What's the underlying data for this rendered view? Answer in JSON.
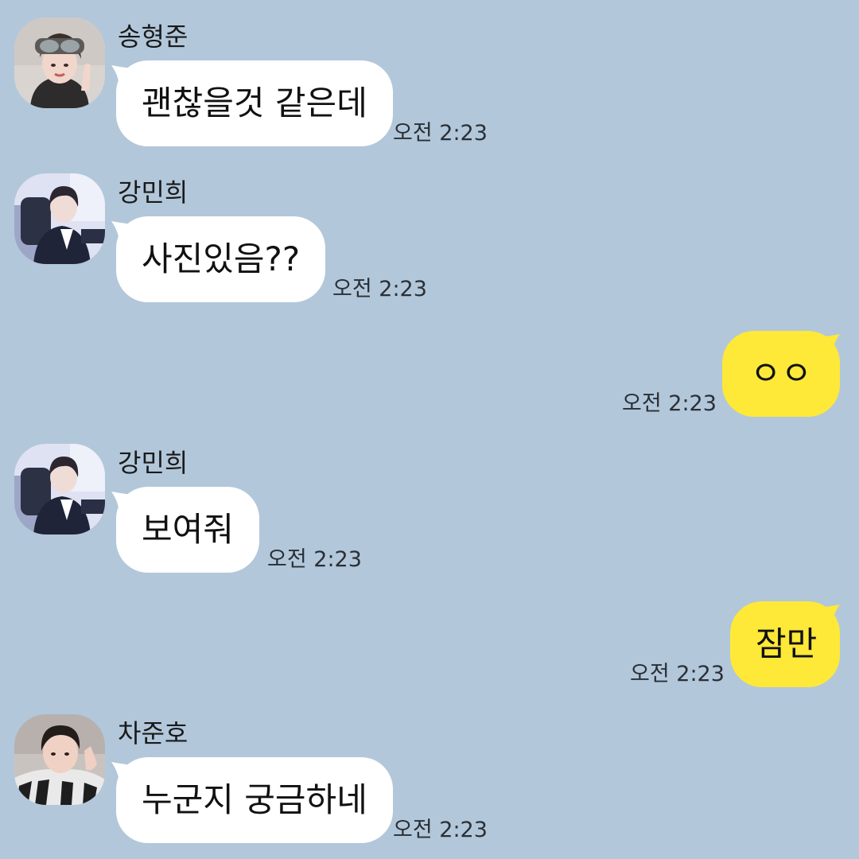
{
  "colors": {
    "background": "#b2c7da",
    "incoming_bubble": "#ffffff",
    "outgoing_bubble": "#fee838"
  },
  "messages": [
    {
      "direction": "in",
      "sender": "송형준",
      "text": "괜찮을것 같은데",
      "time": "오전 2:23",
      "avatar": "profile-photo-goggles"
    },
    {
      "direction": "in",
      "sender": "강민희",
      "text": "사진있음??",
      "time": "오전 2:23",
      "avatar": "profile-photo-suit"
    },
    {
      "direction": "out",
      "text": "ㅇㅇ",
      "time": "오전 2:23"
    },
    {
      "direction": "in",
      "sender": "강민희",
      "text": "보여줘",
      "time": "오전 2:23",
      "avatar": "profile-photo-suit"
    },
    {
      "direction": "out",
      "text": "잠만",
      "time": "오전 2:23"
    },
    {
      "direction": "in",
      "sender": "차준호",
      "text": "누군지 궁금하네",
      "time": "오전 2:23",
      "avatar": "profile-photo-selfie"
    }
  ]
}
